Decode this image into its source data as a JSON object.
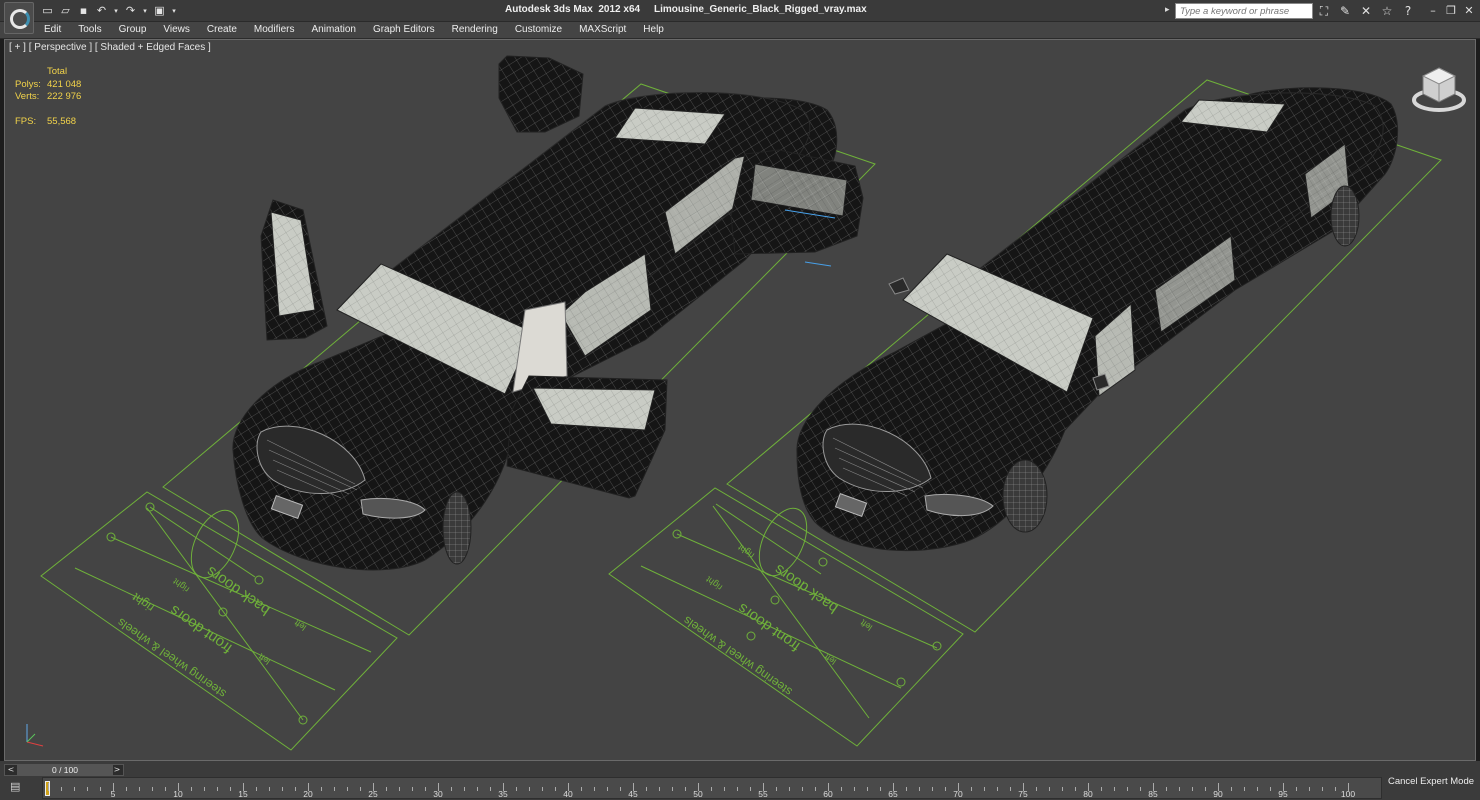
{
  "app": {
    "title": "Autodesk 3ds Max  2012 x64     Limousine_Generic_Black_Rigged_vray.max",
    "search_placeholder": "Type a keyword or phrase"
  },
  "menu": [
    "Edit",
    "Tools",
    "Group",
    "Views",
    "Create",
    "Modifiers",
    "Animation",
    "Graph Editors",
    "Rendering",
    "Customize",
    "MAXScript",
    "Help"
  ],
  "viewport": {
    "label": "[ + ] [ Perspective ] [ Shaded + Edged Faces ]",
    "stats": {
      "total_label": "Total",
      "polys_label": "Polys:",
      "polys": "421 048",
      "verts_label": "Verts:",
      "verts": "222 976",
      "fps_label": "FPS:",
      "fps": "55,568"
    },
    "rig_labels": {
      "back_doors": "back doors",
      "front_doors": "front doors",
      "steering": "steering wheel & wheels",
      "left": "left",
      "right": "right"
    }
  },
  "timeline": {
    "frame_label": "0 / 100",
    "prev": "<",
    "next": ">",
    "ticks": [
      "0",
      "5",
      "10",
      "15",
      "20",
      "25",
      "30",
      "35",
      "40",
      "45",
      "50",
      "55",
      "60",
      "65",
      "70",
      "75",
      "80",
      "85",
      "90",
      "95",
      "100"
    ],
    "expert_mode": "Cancel Expert Mode"
  },
  "colors": {
    "viewport_bg": "#444444",
    "grid_green": "#6fb13a",
    "stats_yellow": "#f2d34a"
  }
}
